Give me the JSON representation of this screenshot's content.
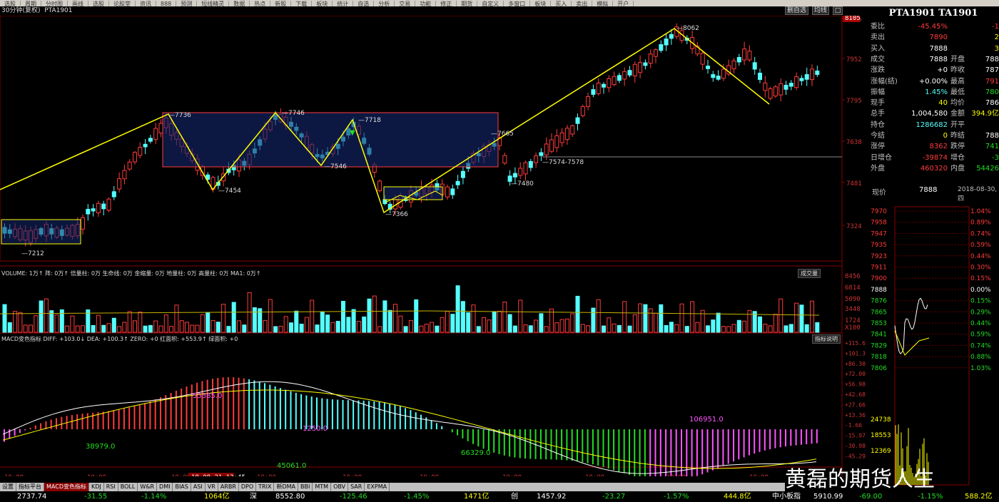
{
  "menu": [
    "选股",
    "周期",
    "分时图",
    "画线",
    "选股",
    "论股堂",
    "资讯",
    "888",
    "预测",
    "短线精灵",
    "数据",
    "热点",
    "新股",
    "下载",
    "板块",
    "统计",
    "自选",
    "分析",
    "交易",
    "功能",
    "修正",
    "期货",
    "自定义",
    "多窗口",
    "板块",
    "买入",
    "卖出",
    "模拟",
    "开户"
  ],
  "header": {
    "period": "30分钟(复权)",
    "symbol": "PTA1901"
  },
  "tools": [
    "删自选",
    "均线",
    "□"
  ],
  "volume_header": {
    "text": "VOLUME: 1万↑ 阵: 0万↑ 倍量柱: 0万 生命线: 0万 金缩量: 0万 地量柱: 0万 高量柱: 0万 MA1: 0万↑",
    "button": "成交量"
  },
  "macd_header": {
    "text": "MACD变色指标 DIFF: +103.0↓ DEA: +100.3↑ ZERO: +0 红面积: +553.9↑ 绿面积: +0",
    "button": "指标说明"
  },
  "price_axis": [
    "8105",
    "7952",
    "7795",
    "7638",
    "7481",
    "7324"
  ],
  "volume_axis": [
    "8456",
    "6814",
    "5090",
    "3448",
    "1724",
    "X100"
  ],
  "macd_axis": [
    "+115.6",
    "+101.3",
    "+86.30",
    "+72.00",
    "+56.98",
    "+42.68",
    "+27.66",
    "+13.36",
    "-1.66",
    "-15.97",
    "-30.98",
    "-45.29"
  ],
  "time_axis": [
    "10:00",
    "10:00",
    "10:00",
    "18-08-21 13:45",
    "10:00",
    "10:00",
    "10:00",
    "10:00",
    "10:00",
    "10:00",
    "10:00"
  ],
  "price_annotations": [
    "7212",
    "7736",
    "7454",
    "7746",
    "7546",
    "7718",
    "7366",
    "7665",
    "7480",
    "7574-7578",
    "8062"
  ],
  "macd_annotations": [
    "38979.0",
    "55385.0",
    "45061.0",
    "1250.0",
    "66329.0",
    "106951.0"
  ],
  "right": {
    "title": "PTA1901 TA1901",
    "rows": [
      {
        "k": "委比",
        "v": "-45.45%",
        "vc": "red",
        "k2": "",
        "v2": "-1",
        "v2c": "red"
      },
      {
        "k": "卖出",
        "v": "7890",
        "vc": "red",
        "k2": "",
        "v2": "2",
        "v2c": "yel"
      },
      {
        "k": "买入",
        "v": "7888",
        "vc": "wht",
        "k2": "",
        "v2": "3",
        "v2c": "yel"
      },
      {
        "k": "成交",
        "v": "7888",
        "vc": "wht",
        "k2": "开盘",
        "v2": "788",
        "v2c": "wht"
      },
      {
        "k": "涨跌",
        "v": "+0",
        "vc": "wht",
        "k2": "昨收",
        "v2": "787",
        "v2c": "wht"
      },
      {
        "k": "涨幅(结)",
        "v": "+0.00%",
        "vc": "wht",
        "k2": "最高",
        "v2": "791",
        "v2c": "red"
      },
      {
        "k": "振幅",
        "v": "1.45%",
        "vc": "cyan",
        "k2": "最低",
        "v2": "780",
        "v2c": "grn"
      },
      {
        "k": "现手",
        "v": "40",
        "vc": "yel",
        "k2": "均价",
        "v2": "786",
        "v2c": "wht"
      },
      {
        "k": "总手",
        "v": "1,004,580",
        "vc": "wht",
        "k2": "金额",
        "v2": "394.9亿",
        "v2c": "yel"
      },
      {
        "k": "持仓",
        "v": "1286682",
        "vc": "cyan",
        "k2": "开平",
        "v2": "",
        "v2c": "wht"
      },
      {
        "k": "今结",
        "v": "0",
        "vc": "yel",
        "k2": "昨结",
        "v2": "788",
        "v2c": "wht"
      },
      {
        "k": "涨停",
        "v": "8362",
        "vc": "red",
        "k2": "跌停",
        "v2": "741",
        "v2c": "grn"
      },
      {
        "k": "日增仓",
        "v": "-39874",
        "vc": "red",
        "k2": "增仓",
        "v2": "-3",
        "v2c": "grn"
      },
      {
        "k": "外盘",
        "v": "460320",
        "vc": "red",
        "k2": "内盘",
        "v2": "54426",
        "v2c": "grn"
      }
    ],
    "now_label": "现价",
    "now_price": "7888",
    "date": "2018-08-30,四",
    "price_ticks": [
      "7970",
      "7958",
      "7947",
      "7935",
      "7923",
      "7911",
      "7900",
      "7888",
      "7876",
      "7865",
      "7853",
      "7841",
      "7829",
      "7818",
      "7806"
    ],
    "pct_ticks": [
      "1.04%",
      "0.89%",
      "0.74%",
      "0.59%",
      "0.44%",
      "0.30%",
      "0.15%",
      "0.00%",
      "0.15%",
      "0.29%",
      "0.44%",
      "0.59%",
      "0.74%",
      "0.88%",
      "1.03%"
    ],
    "vol_ticks": [
      "24738",
      "18553",
      "12369"
    ]
  },
  "tabs": [
    "设置",
    "指标平台",
    "MACD变色指标",
    "KDJ",
    "RSI",
    "BOLL",
    "W&R",
    "DMI",
    "BIAS",
    "ASI",
    "VR",
    "ARBR",
    "DPO",
    "TRIX",
    "新DMA",
    "BBI",
    "MTM",
    "OBV",
    "SAR",
    "EXPMA"
  ],
  "active_tab": 2,
  "status": {
    "a1": "2737.74",
    "a2": "-31.55",
    "a3": "-1.14%",
    "a4": "1064亿",
    "b0": "深",
    "b1": "8552.80",
    "b2": "-125.46",
    "b3": "-1.45%",
    "b4": "1471亿",
    "c0": "创",
    "c1": "1457.92",
    "c2": "-23.27",
    "c3": "-1.57%",
    "c4": "444.8亿",
    "d0": "中小板指",
    "d1": "5910.99",
    "d2": "-69.00",
    "d3": "-1.15%",
    "d4": "588.2亿"
  },
  "watermark": "黄磊的期货人生"
}
